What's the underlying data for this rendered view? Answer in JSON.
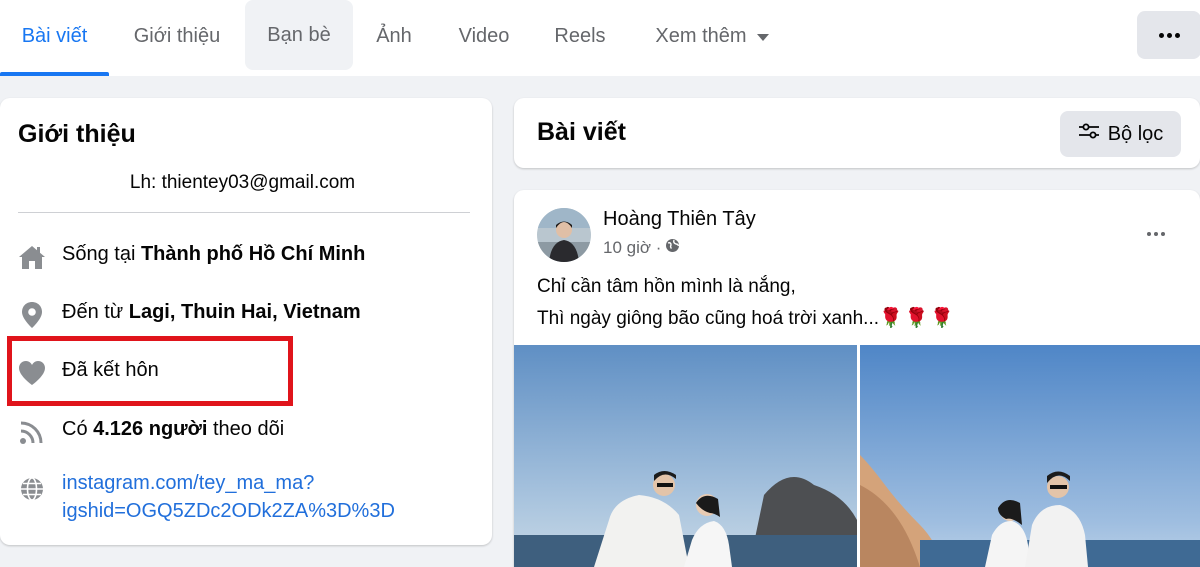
{
  "tabs": [
    {
      "label": "Bài viết",
      "active": true
    },
    {
      "label": "Giới thiệu"
    },
    {
      "label": "Bạn bè"
    },
    {
      "label": "Ảnh"
    },
    {
      "label": "Video"
    },
    {
      "label": "Reels"
    },
    {
      "label": "Xem thêm"
    }
  ],
  "intro": {
    "title": "Giới thiệu",
    "bio": "Lh: thientey03@gmail.com",
    "lives_prefix": "Sống tại ",
    "lives_city": "Thành phố Hồ Chí Minh",
    "from_prefix": "Đến từ ",
    "from_place": "Lagi, Thuin Hai, Vietnam",
    "relationship": "Đã kết hôn",
    "followers_prefix": "Có ",
    "followers_count": "4.126 người",
    "followers_suffix": " theo dõi",
    "link_line1": "instagram.com/tey_ma_ma?",
    "link_line2": "igshid=OGQ5ZDc2ODk2ZA%3D%3D"
  },
  "posts": {
    "title": "Bài viết",
    "filter_label": "Bộ lọc"
  },
  "post": {
    "author": "Hoàng Thiên Tây",
    "time": "10 giờ ·",
    "line1": "Chỉ cần tâm hồn mình là nắng,",
    "line2": "Thì ngày giông bão cũng hoá trời xanh...",
    "roses": "🌹🌹🌹"
  },
  "colors": {
    "accent": "#1877f2",
    "highlight": "#e0141b",
    "link": "#216fdb"
  }
}
